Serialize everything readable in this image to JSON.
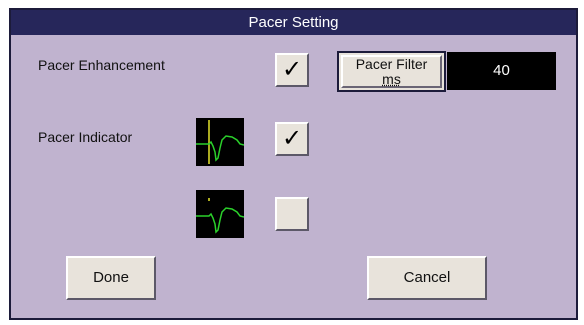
{
  "dialog": {
    "title": "Pacer Setting",
    "pacer_enhancement": {
      "label": "Pacer Enhancement",
      "checked": true,
      "check_glyph": "✓"
    },
    "pacer_filter": {
      "label_line1": "Pacer Filter",
      "label_line2": "ms",
      "value": "40"
    },
    "pacer_indicator": {
      "label": "Pacer Indicator",
      "checked": true,
      "check_glyph": "✓"
    },
    "indicator_off_option": {
      "checked": false
    },
    "buttons": {
      "done": "Done",
      "cancel": "Cancel"
    }
  },
  "colors": {
    "title_bar": "#26265a",
    "dialog_bg": "#c0b3cf",
    "waveform": "#2bd12b",
    "pacer_marker": "#e6e62a"
  }
}
